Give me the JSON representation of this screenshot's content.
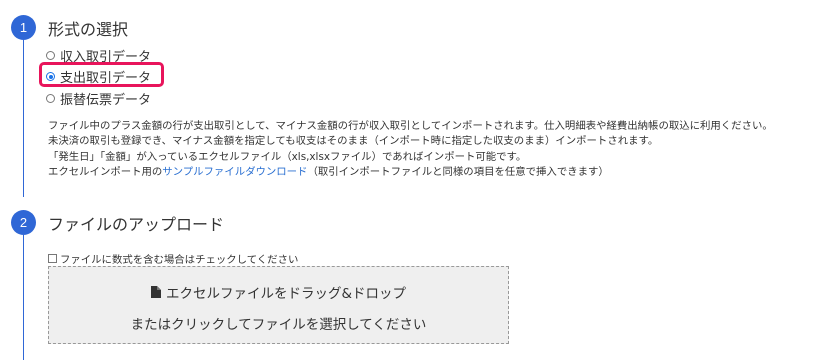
{
  "steps": [
    {
      "number": "1",
      "title": "形式の選択"
    },
    {
      "number": "2",
      "title": "ファイルのアップロード"
    }
  ],
  "format_options": [
    {
      "label": "収入取引データ",
      "checked": false
    },
    {
      "label": "支出取引データ",
      "checked": true
    },
    {
      "label": "振替伝票データ",
      "checked": false
    }
  ],
  "description": {
    "line1": "ファイル中のプラス金額の行が支出取引として、マイナス金額の行が収入取引としてインポートされます。仕入明細表や経費出納帳の取込に利用ください。",
    "line2": "未決済の取引も登録でき、マイナス金額を指定しても収支はそのまま（インポート時に指定した収支のまま）インポートされます。",
    "line3": "「発生日」「金額」が入っているエクセルファイル（xls,xlsxファイル）であればインポート可能です。",
    "line4_prefix": "エクセルインポート用の",
    "line4_link": "サンプルファイルダウンロード",
    "line4_suffix": "（取引インポートファイルと同様の項目を任意で挿入できます）"
  },
  "formula_checkbox": {
    "label": "ファイルに数式を含む場合はチェックしてください",
    "checked": false
  },
  "dropzone": {
    "drag_label": "エクセルファイルをドラッグ&ドロップ",
    "click_label": "またはクリックしてファイルを選択してください"
  },
  "colors": {
    "accent": "#2f67d6",
    "highlight": "#e8145b",
    "link": "#2a6fd1",
    "dropzone_bg": "#efefef"
  },
  "icons": {
    "file": "file-icon"
  }
}
